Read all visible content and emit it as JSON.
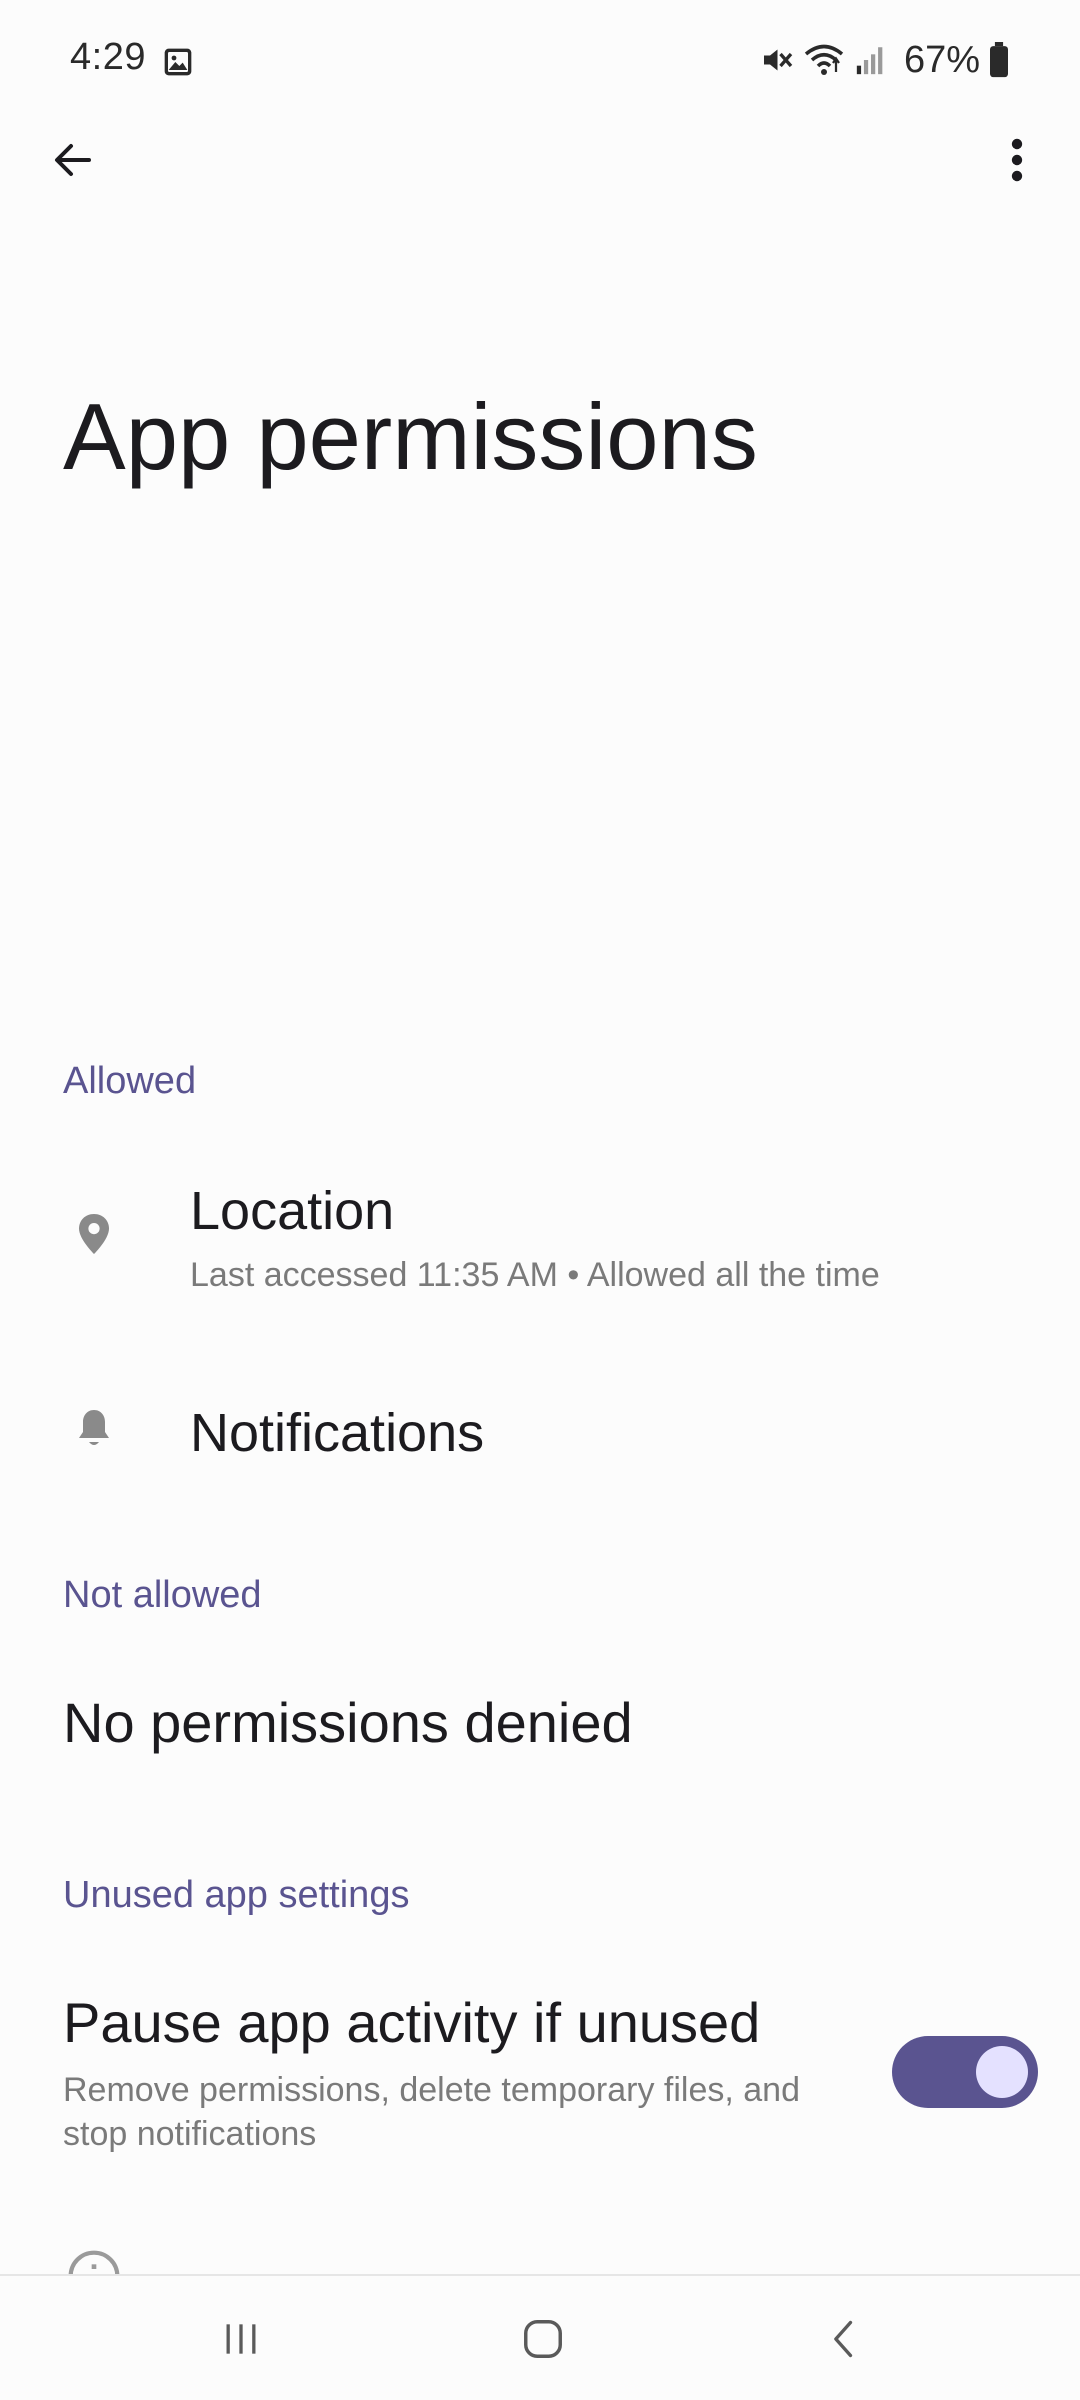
{
  "status_bar": {
    "time": "4:29",
    "battery": "67%"
  },
  "header": {
    "title": "App permissions"
  },
  "sections": {
    "allowed": {
      "label": "Allowed",
      "items": [
        {
          "title": "Location",
          "subtitle": "Last accessed 11:35 AM • Allowed all the time",
          "icon": "location-pin-icon"
        },
        {
          "title": "Notifications",
          "subtitle": "",
          "icon": "bell-icon"
        }
      ]
    },
    "not_allowed": {
      "label": "Not allowed",
      "empty_text": "No permissions denied"
    },
    "unused": {
      "label": "Unused app settings",
      "pause_title": "Pause app activity if unused",
      "pause_subtitle": "Remove permissions, delete temporary files, and stop notifications",
      "pause_enabled": true
    }
  },
  "colors": {
    "accent": "#5a5490",
    "toggle_knob": "#e4e1ff",
    "background": "#fcfcfc"
  }
}
